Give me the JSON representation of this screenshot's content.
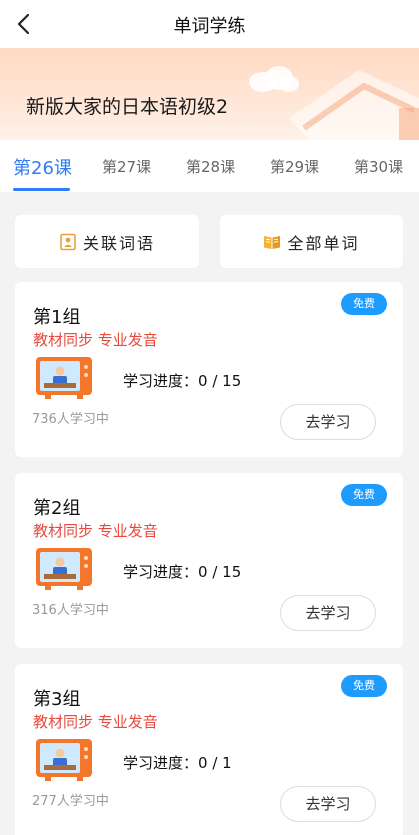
{
  "nav": {
    "title": "单词学练"
  },
  "banner": {
    "book_title": "新版大家的日本语初级2"
  },
  "tabs": [
    {
      "label": "第26课",
      "active": true
    },
    {
      "label": "第27课"
    },
    {
      "label": "第28课"
    },
    {
      "label": "第29课"
    },
    {
      "label": "第30课"
    }
  ],
  "actions": {
    "related_label": "关联词语",
    "all_label": "全部单词"
  },
  "colors": {
    "accent": "#2f7cf6",
    "free_badge": "#1e9bff",
    "subtitle_red": "#e84a3e",
    "tv_orange": "#f4762a"
  },
  "groups": [
    {
      "title": "第1组",
      "subtitle": "教材同步 专业发音",
      "badge": "免费",
      "progress_label": "学习进度：",
      "progress": "0 / 15",
      "learners": "736人学习中",
      "button": "去学习"
    },
    {
      "title": "第2组",
      "subtitle": "教材同步 专业发音",
      "badge": "免费",
      "progress_label": "学习进度：",
      "progress": "0 / 15",
      "learners": "316人学习中",
      "button": "去学习"
    },
    {
      "title": "第3组",
      "subtitle": "教材同步 专业发音",
      "badge": "免费",
      "progress_label": "学习进度：",
      "progress": "0 / 1",
      "learners": "277人学习中",
      "button": "去学习"
    }
  ]
}
